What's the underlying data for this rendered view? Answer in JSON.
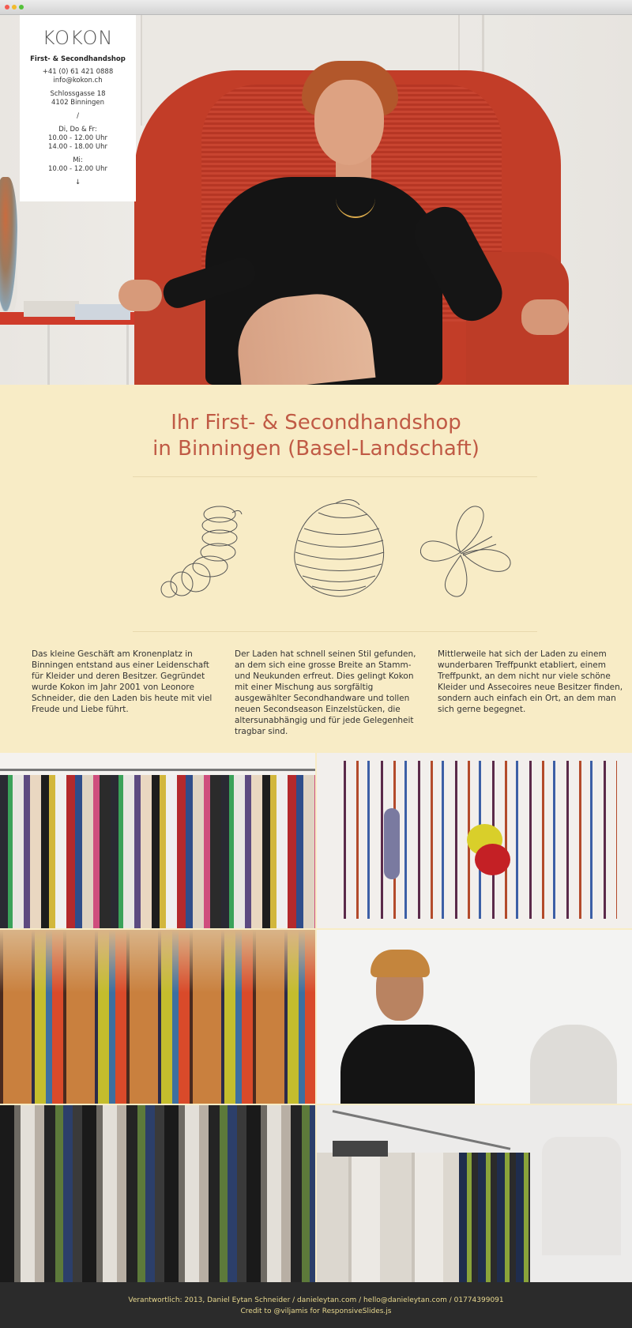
{
  "brand": {
    "logo": "KOKON"
  },
  "info": {
    "title": "First- & Secondhandshop",
    "phone": "+41 (0) 61 421 0888",
    "email": "info@kokon.ch",
    "street": "Schlossgasse 18",
    "city": "4102 Binningen",
    "separator": "/",
    "days1": "Di, Do & Fr:",
    "hours1a": "10.00 - 12.00 Uhr",
    "hours1b": "14.00 - 18.00 Uhr",
    "days2": "Mi:",
    "hours2": "10.00 - 12.00 Uhr",
    "arrow": "↓"
  },
  "intro": {
    "headline_line1": "Ihr First- & Secondhandshop",
    "headline_line2": "in Binningen (Basel-Landschaft)",
    "columns": [
      "Das kleine Geschäft am Kronenplatz in Binningen entstand aus einer Leidenschaft für Kleider und deren Besitzer. Gegründet wurde Kokon im Jahr 2001 von Leonore Schneider, die den Laden bis heute mit viel Freude und Liebe führt.",
      "Der Laden hat schnell seinen Stil gefunden, an dem sich eine grosse Breite an Stamm- und Neukunden erfreut. Dies gelingt Kokon mit einer Mischung aus sorgfältig ausgewählter Secondhandware und tollen neuen Secondseason Einzelstücken, die altersunabhängig und für jede Gelegenheit tragbar sind.",
      "Mittlerweile hat sich der Laden zu einem wunderbaren Treffpunkt etabliert, einem Treffpunkt, an dem nicht nur viele schöne Kleider und Assecoires neue Besitzer finden, sondern auch einfach ein Ort, an dem man sich gerne begegnet."
    ]
  },
  "icons": [
    "caterpillar-icon",
    "cocoon-icon",
    "butterfly-icon"
  ],
  "footer": {
    "line1": "Verantwortlich: 2013, Daniel Eytan Schneider / danieleytan.com / hello@danieleytan.com / 01774399091",
    "line2": "Credit to @viljamis for ResponsiveSlides.js"
  },
  "colors": {
    "accent": "#c05a45",
    "background": "#f8ecc6",
    "footer": "#2b2b2b",
    "footer_text": "#e8d88f"
  }
}
